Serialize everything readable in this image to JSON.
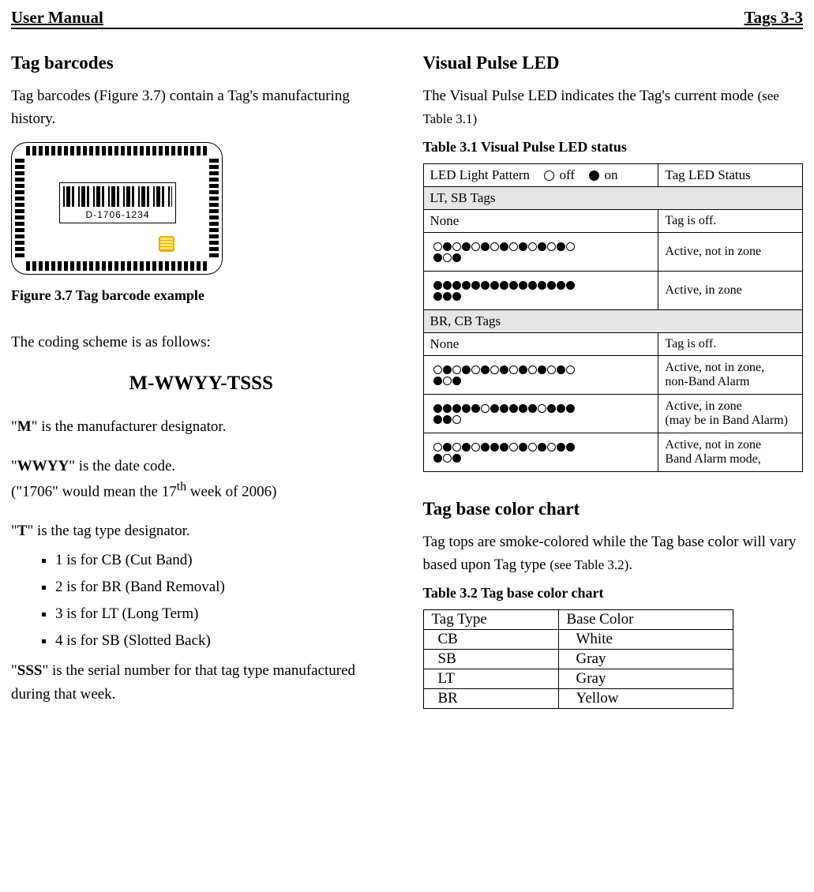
{
  "header": {
    "left": "User Manual",
    "right": "Tags 3-3"
  },
  "barcodes": {
    "title": "Tag barcodes",
    "intro": "Tag barcodes (Figure 3.7) contain a Tag's manufacturing history.",
    "fig_label": "D-1706-1234",
    "fig_caption": "Figure 3.7 Tag barcode example",
    "scheme_intro": "The coding scheme is as follows:",
    "scheme": "M-WWYY-TSSS",
    "m_line_pre": "\"",
    "m_line_b": "M",
    "m_line_post": "\" is the manufacturer designator.",
    "wwyy_line_pre": "\"",
    "wwyy_line_b": "WWYY",
    "wwyy_line_post": "\" is the date code.",
    "wwyy_example": "(\"1706\" would mean the 17th week of 2006)",
    "wwyy_example_pre": "(\"1706\" would mean the 17",
    "wwyy_example_sup": "th",
    "wwyy_example_post": " week of 2006)",
    "t_line_pre": "\"",
    "t_line_b": "T",
    "t_line_post": "\" is the tag type designator.",
    "t_items": [
      "1 is for CB (Cut Band)",
      "2 is for BR (Band Removal)",
      "3 is for LT (Long Term)",
      "4 is for SB (Slotted Back)"
    ],
    "sss_line_pre": "\"",
    "sss_line_b": "SSS",
    "sss_line_post": "\" is the serial number for that tag type manufactured during that week."
  },
  "led": {
    "title": "Visual Pulse LED",
    "intro_a": "The Visual Pulse LED indicates the Tag's current mode ",
    "intro_b": "(see Table 3.1)",
    "caption": "Table 3.1 Visual Pulse LED status",
    "header_pattern": "LED Light Pattern",
    "legend_off": "off",
    "legend_on": "on",
    "header_status": "Tag LED Status",
    "section1": "LT, SB Tags",
    "none_label": "None",
    "lt_none_status": "Tag is off.",
    "lt_row2_pattern": [
      0,
      1,
      0,
      1,
      0,
      1,
      0,
      1,
      0,
      1,
      0,
      1,
      0,
      1,
      0,
      1,
      0,
      1
    ],
    "lt_row2_status": "Active, not in zone",
    "lt_row3_pattern": [
      1,
      1,
      1,
      1,
      1,
      1,
      1,
      1,
      1,
      1,
      1,
      1,
      1,
      1,
      1,
      1,
      1,
      1
    ],
    "lt_row3_status": "Active, in zone",
    "section2": "BR, CB Tags",
    "br_none_status": "Tag is off.",
    "br_row2_pattern": [
      0,
      1,
      0,
      1,
      0,
      1,
      0,
      1,
      0,
      1,
      0,
      1,
      0,
      1,
      0,
      1,
      0,
      1
    ],
    "br_row2_status_a": "Active, not in zone,",
    "br_row2_status_b": "non-Band Alarm",
    "br_row3_pattern": [
      1,
      1,
      1,
      1,
      1,
      0,
      1,
      1,
      1,
      1,
      1,
      0,
      1,
      1,
      1,
      1,
      1,
      0
    ],
    "br_row3_status_a": "Active, in zone",
    "br_row3_status_b": "(may be in Band Alarm)",
    "br_row4_pattern": [
      0,
      1,
      0,
      1,
      0,
      1,
      1,
      1,
      0,
      1,
      0,
      1,
      0,
      1,
      1,
      1,
      0,
      1
    ],
    "br_row4_status_a": "Active, not in zone",
    "br_row4_status_b": "Band Alarm mode,"
  },
  "base": {
    "title": "Tag base color chart",
    "intro_a": "Tag tops are smoke-colored while the Tag base color will vary based upon Tag type ",
    "intro_b": "(see Table 3.2)",
    "intro_c": ".",
    "caption": "Table 3.2 Tag base color chart",
    "col1": "Tag Type",
    "col2": "Base Color",
    "rows": [
      {
        "type": "CB",
        "color": "White"
      },
      {
        "type": "SB",
        "color": "Gray"
      },
      {
        "type": "LT",
        "color": "Gray"
      },
      {
        "type": "BR",
        "color": "Yellow"
      }
    ]
  }
}
